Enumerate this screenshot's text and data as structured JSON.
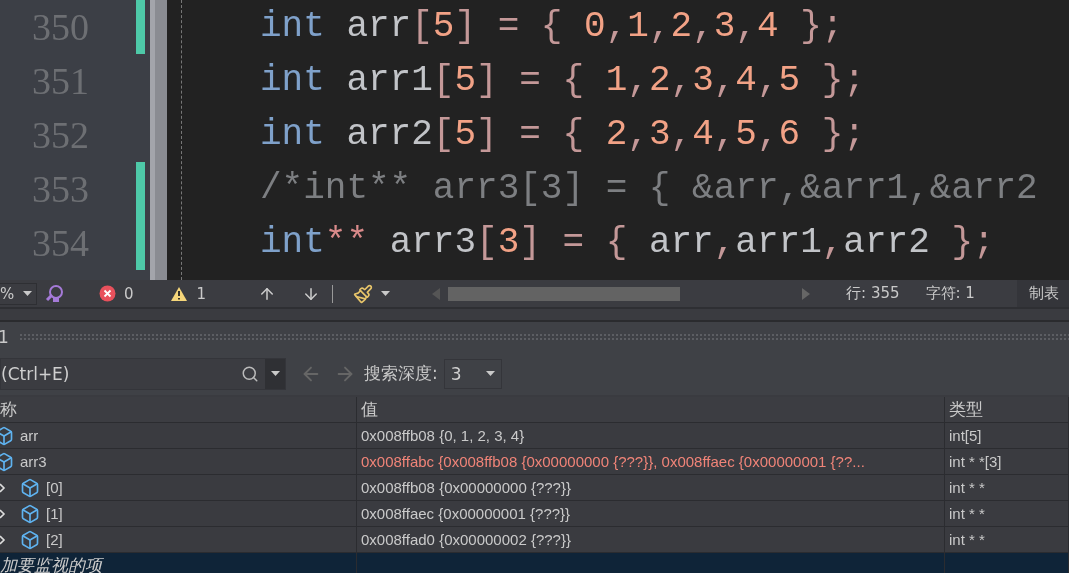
{
  "editor": {
    "lines": [
      {
        "number": "350",
        "modified": true,
        "tokens": [
          {
            "kind": "kw",
            "text": "int"
          },
          {
            "kind": "id",
            "text": " arr"
          },
          {
            "kind": "br",
            "text": "["
          },
          {
            "kind": "num",
            "text": "5"
          },
          {
            "kind": "br",
            "text": "] = { "
          },
          {
            "kind": "num",
            "text": "0"
          },
          {
            "kind": "br",
            "text": ","
          },
          {
            "kind": "num",
            "text": "1"
          },
          {
            "kind": "br",
            "text": ","
          },
          {
            "kind": "num",
            "text": "2"
          },
          {
            "kind": "br",
            "text": ","
          },
          {
            "kind": "num",
            "text": "3"
          },
          {
            "kind": "br",
            "text": ","
          },
          {
            "kind": "num",
            "text": "4"
          },
          {
            "kind": "br",
            "text": " };"
          }
        ]
      },
      {
        "number": "351",
        "modified": false,
        "tokens": [
          {
            "kind": "kw",
            "text": "int"
          },
          {
            "kind": "id",
            "text": " arr1"
          },
          {
            "kind": "br",
            "text": "["
          },
          {
            "kind": "num",
            "text": "5"
          },
          {
            "kind": "br",
            "text": "] = { "
          },
          {
            "kind": "num",
            "text": "1"
          },
          {
            "kind": "br",
            "text": ","
          },
          {
            "kind": "num",
            "text": "2"
          },
          {
            "kind": "br",
            "text": ","
          },
          {
            "kind": "num",
            "text": "3"
          },
          {
            "kind": "br",
            "text": ","
          },
          {
            "kind": "num",
            "text": "4"
          },
          {
            "kind": "br",
            "text": ","
          },
          {
            "kind": "num",
            "text": "5"
          },
          {
            "kind": "br",
            "text": " };"
          }
        ]
      },
      {
        "number": "352",
        "modified": false,
        "tokens": [
          {
            "kind": "kw",
            "text": "int"
          },
          {
            "kind": "id",
            "text": " arr2"
          },
          {
            "kind": "br",
            "text": "["
          },
          {
            "kind": "num",
            "text": "5"
          },
          {
            "kind": "br",
            "text": "] = { "
          },
          {
            "kind": "num",
            "text": "2"
          },
          {
            "kind": "br",
            "text": ","
          },
          {
            "kind": "num",
            "text": "3"
          },
          {
            "kind": "br",
            "text": ","
          },
          {
            "kind": "num",
            "text": "4"
          },
          {
            "kind": "br",
            "text": ","
          },
          {
            "kind": "num",
            "text": "5"
          },
          {
            "kind": "br",
            "text": ","
          },
          {
            "kind": "num",
            "text": "6"
          },
          {
            "kind": "br",
            "text": " };"
          }
        ]
      },
      {
        "number": "353",
        "modified": true,
        "tokens": [
          {
            "kind": "cm",
            "text": "/*int** arr3[3] = { &arr,&arr1,&arr2"
          }
        ]
      },
      {
        "number": "354",
        "modified": true,
        "tokens": [
          {
            "kind": "kw",
            "text": "int"
          },
          {
            "kind": "op",
            "text": "**"
          },
          {
            "kind": "id",
            "text": " arr3"
          },
          {
            "kind": "br",
            "text": "["
          },
          {
            "kind": "num",
            "text": "3"
          },
          {
            "kind": "br",
            "text": "] = { "
          },
          {
            "kind": "id",
            "text": "arr"
          },
          {
            "kind": "br",
            "text": ","
          },
          {
            "kind": "id",
            "text": "arr1"
          },
          {
            "kind": "br",
            "text": ","
          },
          {
            "kind": "id",
            "text": "arr2"
          },
          {
            "kind": "br",
            "text": " };"
          }
        ]
      }
    ]
  },
  "status_bar": {
    "zoom": "%",
    "errors": "0",
    "warnings": "1",
    "line": "行: 355",
    "column": "字符: 1",
    "tabs": "制表"
  },
  "watch_panel": {
    "title": "1",
    "search": {
      "placeholder": "(Ctrl+E)"
    },
    "search_depth_label": "搜索深度:",
    "search_depth": "3",
    "columns": [
      "称",
      "值",
      "类型"
    ],
    "rows": [
      {
        "name": "arr",
        "value": "0x008ffb08 {0, 1, 2, 3, 4}",
        "type": "int[5]",
        "changed": false
      },
      {
        "name": "arr3",
        "value": "0x008ffabc {0x008ffb08 {0x00000000 {???}}, 0x008ffaec {0x00000001 {??...",
        "type": "int * *[3]",
        "changed": true,
        "children": [
          {
            "name": "[0]",
            "value": "0x008ffb08 {0x00000000 {???}}",
            "type": "int * *",
            "changed": false,
            "expandable": true
          },
          {
            "name": "[1]",
            "value": "0x008ffaec {0x00000001 {???}}",
            "type": "int * *",
            "changed": false,
            "expandable": true
          },
          {
            "name": "[2]",
            "value": "0x008ffad0 {0x00000002 {???}}",
            "type": "int * *",
            "changed": false,
            "expandable": true
          }
        ]
      }
    ],
    "add_row": {
      "text": "加要监视的项",
      "selected": true
    }
  }
}
